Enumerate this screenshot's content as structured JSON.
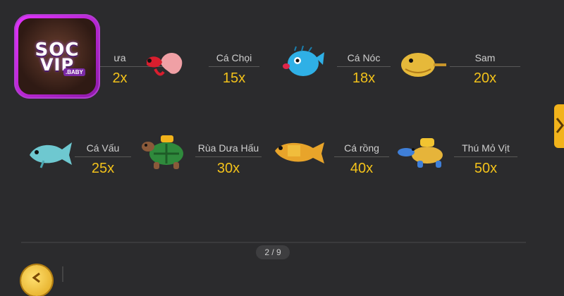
{
  "logo": {
    "line1": "SOC",
    "line2": "VIP",
    "badge": ".BABY"
  },
  "fish_row1": [
    {
      "name": "ưa",
      "multiplier": "2x",
      "icon": "red-fish-icon"
    },
    {
      "name": "Cá Chọi",
      "multiplier": "15x",
      "icon": "betta-fish-icon"
    },
    {
      "name": "Cá Nóc",
      "multiplier": "18x",
      "icon": "pufferfish-icon"
    },
    {
      "name": "Sam",
      "multiplier": "20x",
      "icon": "horseshoe-crab-icon"
    }
  ],
  "fish_row2": [
    {
      "name": "Cá Vấu",
      "multiplier": "25x",
      "icon": "blue-fish-icon"
    },
    {
      "name": "Rùa Dưa Hấu",
      "multiplier": "30x",
      "icon": "watermelon-turtle-icon"
    },
    {
      "name": "Cá rồng",
      "multiplier": "40x",
      "icon": "arowana-icon"
    },
    {
      "name": "Thú Mỏ Vịt",
      "multiplier": "50x",
      "icon": "platypus-icon"
    }
  ],
  "pager": {
    "text": "2 / 9"
  },
  "colors": {
    "background": "#2b2b2d",
    "multiplier": "#f3c21a",
    "accent": "#f2b31b"
  }
}
